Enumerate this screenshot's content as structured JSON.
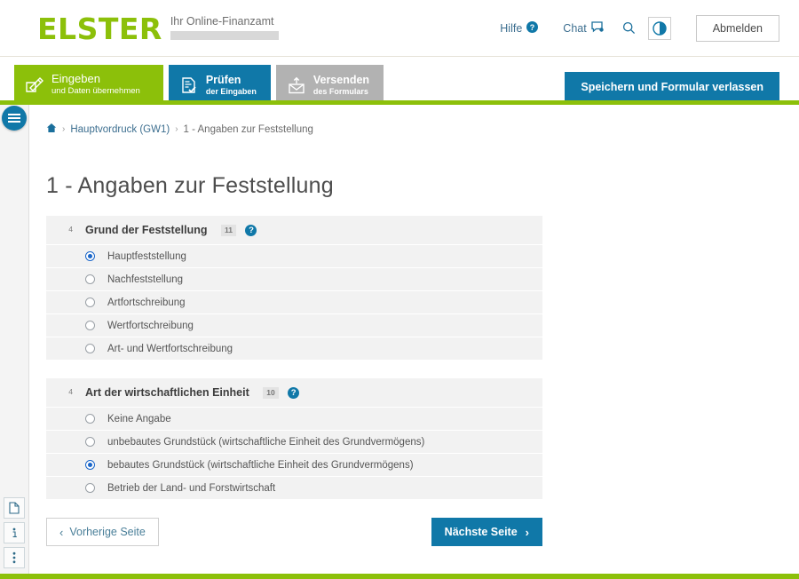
{
  "header": {
    "logo_word": "ELSTER",
    "logo_tagline": "Ihr Online-Finanzamt",
    "help_label": "Hilfe",
    "chat_label": "Chat",
    "search_icon": "search-icon",
    "contrast_icon": "contrast-toggle-icon",
    "logout_label": "Abmelden",
    "accent_green": "#8CC00A",
    "accent_blue": "#1078A8"
  },
  "tabs": [
    {
      "title": "Eingeben",
      "subtitle": "und Daten übernehmen",
      "state": "green",
      "icon": "pencil-form-icon"
    },
    {
      "title": "Prüfen",
      "subtitle": "der Eingaben",
      "state": "blue",
      "icon": "checked-document-icon"
    },
    {
      "title": "Versenden",
      "subtitle": "des Formulars",
      "state": "gray",
      "icon": "envelope-upload-icon"
    }
  ],
  "toolbar": {
    "save_and_exit_label": "Speichern und Formular verlassen"
  },
  "rail": {
    "menu_icon": "hamburger-menu-icon",
    "tools": [
      {
        "icon": "document-icon",
        "name": "document-tool"
      },
      {
        "icon": "info-icon",
        "name": "info-tool"
      },
      {
        "icon": "more-vertical-icon",
        "name": "more-options-tool"
      }
    ]
  },
  "breadcrumb": {
    "home_icon": "home-icon",
    "separator": "›",
    "items": [
      {
        "label": "Hauptvordruck (GW1)",
        "current": false
      },
      {
        "label": "1 - Angaben zur Feststellung",
        "current": true
      }
    ]
  },
  "page": {
    "title": "1 - Angaben zur Feststellung"
  },
  "fieldsets": [
    {
      "line_no": "4",
      "title": "Grund der Feststellung",
      "field_number": "11",
      "help": "?",
      "options": [
        {
          "label": "Hauptfeststellung",
          "selected": true
        },
        {
          "label": "Nachfeststellung",
          "selected": false
        },
        {
          "label": "Artfortschreibung",
          "selected": false
        },
        {
          "label": "Wertfortschreibung",
          "selected": false
        },
        {
          "label": "Art- und Wertfortschreibung",
          "selected": false
        }
      ]
    },
    {
      "line_no": "4",
      "title": "Art der wirtschaftlichen Einheit",
      "field_number": "10",
      "help": "?",
      "options": [
        {
          "label": "Keine Angabe",
          "selected": false
        },
        {
          "label": "unbebautes Grundstück (wirtschaftliche Einheit des Grundvermögens)",
          "selected": false
        },
        {
          "label": "bebautes Grundstück (wirtschaftliche Einheit des Grundvermögens)",
          "selected": true
        },
        {
          "label": "Betrieb der Land- und Forstwirtschaft",
          "selected": false
        }
      ]
    }
  ],
  "pagenav": {
    "prev_label": "Vorherige Seite",
    "next_label": "Nächste Seite",
    "prev_chevron": "‹",
    "next_chevron": "›"
  }
}
